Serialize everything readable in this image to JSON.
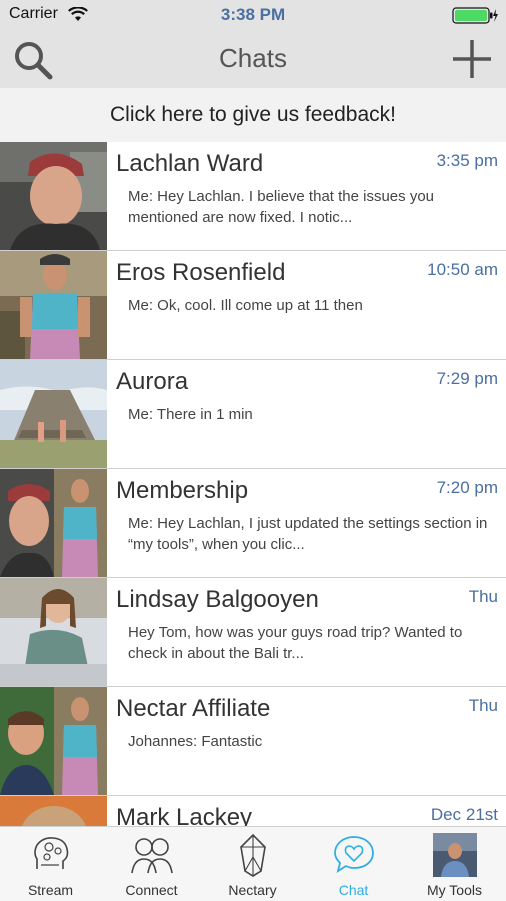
{
  "status_bar": {
    "carrier": "Carrier",
    "time": "3:38 PM"
  },
  "nav": {
    "title": "Chats"
  },
  "feedback": {
    "label": "Click here to give us feedback!"
  },
  "chats": [
    {
      "name": "Lachlan Ward",
      "time": "3:35 pm",
      "message": "Me: Hey Lachlan. I believe that the issues you mentioned are now fixed. I notic..."
    },
    {
      "name": "Eros Rosenfield",
      "time": "10:50 am",
      "message": "Me: Ok, cool. Ill come up at 11 then"
    },
    {
      "name": "Aurora",
      "time": "7:29 pm",
      "message": "Me: There in 1 min"
    },
    {
      "name": "Membership",
      "time": "7:20 pm",
      "message": "Me: Hey Lachlan, I just updated the settings section in “my tools”, when you clic..."
    },
    {
      "name": "Lindsay Balgooyen",
      "time": "Thu",
      "message": "Hey Tom, how was your guys road trip? Wanted to check in about the Bali tr..."
    },
    {
      "name": "Nectar Affiliate",
      "time": "Thu",
      "message": "Johannes: Fantastic"
    },
    {
      "name": "Mark Lackey",
      "time": "Dec 21st",
      "message": ""
    }
  ],
  "tabs": [
    {
      "label": "Stream",
      "icon": "brain-icon"
    },
    {
      "label": "Connect",
      "icon": "people-icon"
    },
    {
      "label": "Nectary",
      "icon": "crystal-icon"
    },
    {
      "label": "Chat",
      "icon": "heart-chat-icon"
    },
    {
      "label": "My Tools",
      "icon": "profile-photo-icon"
    }
  ],
  "colors": {
    "active_tab": "#2eaee3",
    "time_text": "#4a6fa0",
    "bar_bg": "#e3e3e3"
  }
}
